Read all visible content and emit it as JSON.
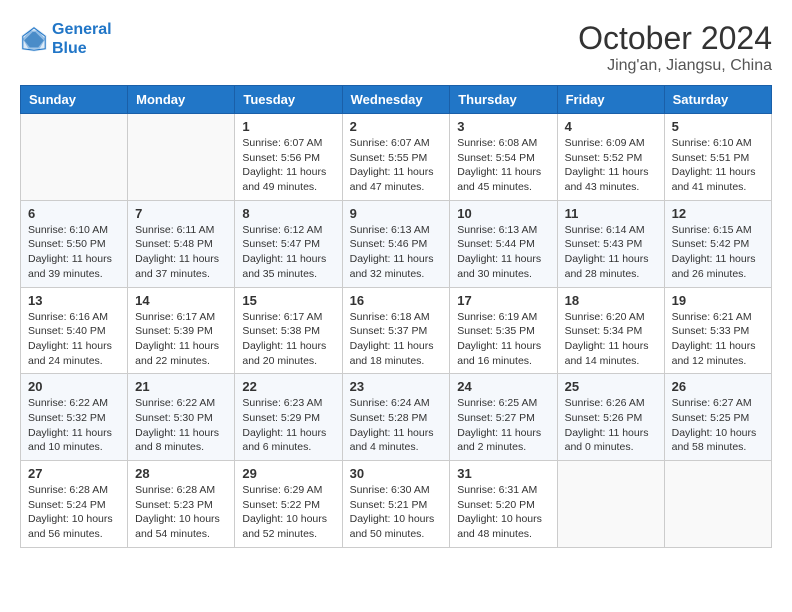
{
  "logo": {
    "line1": "General",
    "line2": "Blue"
  },
  "title": "October 2024",
  "location": "Jing'an, Jiangsu, China",
  "weekdays": [
    "Sunday",
    "Monday",
    "Tuesday",
    "Wednesday",
    "Thursday",
    "Friday",
    "Saturday"
  ],
  "weeks": [
    [
      {
        "day": "",
        "info": ""
      },
      {
        "day": "",
        "info": ""
      },
      {
        "day": "1",
        "sunrise": "Sunrise: 6:07 AM",
        "sunset": "Sunset: 5:56 PM",
        "daylight": "Daylight: 11 hours and 49 minutes."
      },
      {
        "day": "2",
        "sunrise": "Sunrise: 6:07 AM",
        "sunset": "Sunset: 5:55 PM",
        "daylight": "Daylight: 11 hours and 47 minutes."
      },
      {
        "day": "3",
        "sunrise": "Sunrise: 6:08 AM",
        "sunset": "Sunset: 5:54 PM",
        "daylight": "Daylight: 11 hours and 45 minutes."
      },
      {
        "day": "4",
        "sunrise": "Sunrise: 6:09 AM",
        "sunset": "Sunset: 5:52 PM",
        "daylight": "Daylight: 11 hours and 43 minutes."
      },
      {
        "day": "5",
        "sunrise": "Sunrise: 6:10 AM",
        "sunset": "Sunset: 5:51 PM",
        "daylight": "Daylight: 11 hours and 41 minutes."
      }
    ],
    [
      {
        "day": "6",
        "sunrise": "Sunrise: 6:10 AM",
        "sunset": "Sunset: 5:50 PM",
        "daylight": "Daylight: 11 hours and 39 minutes."
      },
      {
        "day": "7",
        "sunrise": "Sunrise: 6:11 AM",
        "sunset": "Sunset: 5:48 PM",
        "daylight": "Daylight: 11 hours and 37 minutes."
      },
      {
        "day": "8",
        "sunrise": "Sunrise: 6:12 AM",
        "sunset": "Sunset: 5:47 PM",
        "daylight": "Daylight: 11 hours and 35 minutes."
      },
      {
        "day": "9",
        "sunrise": "Sunrise: 6:13 AM",
        "sunset": "Sunset: 5:46 PM",
        "daylight": "Daylight: 11 hours and 32 minutes."
      },
      {
        "day": "10",
        "sunrise": "Sunrise: 6:13 AM",
        "sunset": "Sunset: 5:44 PM",
        "daylight": "Daylight: 11 hours and 30 minutes."
      },
      {
        "day": "11",
        "sunrise": "Sunrise: 6:14 AM",
        "sunset": "Sunset: 5:43 PM",
        "daylight": "Daylight: 11 hours and 28 minutes."
      },
      {
        "day": "12",
        "sunrise": "Sunrise: 6:15 AM",
        "sunset": "Sunset: 5:42 PM",
        "daylight": "Daylight: 11 hours and 26 minutes."
      }
    ],
    [
      {
        "day": "13",
        "sunrise": "Sunrise: 6:16 AM",
        "sunset": "Sunset: 5:40 PM",
        "daylight": "Daylight: 11 hours and 24 minutes."
      },
      {
        "day": "14",
        "sunrise": "Sunrise: 6:17 AM",
        "sunset": "Sunset: 5:39 PM",
        "daylight": "Daylight: 11 hours and 22 minutes."
      },
      {
        "day": "15",
        "sunrise": "Sunrise: 6:17 AM",
        "sunset": "Sunset: 5:38 PM",
        "daylight": "Daylight: 11 hours and 20 minutes."
      },
      {
        "day": "16",
        "sunrise": "Sunrise: 6:18 AM",
        "sunset": "Sunset: 5:37 PM",
        "daylight": "Daylight: 11 hours and 18 minutes."
      },
      {
        "day": "17",
        "sunrise": "Sunrise: 6:19 AM",
        "sunset": "Sunset: 5:35 PM",
        "daylight": "Daylight: 11 hours and 16 minutes."
      },
      {
        "day": "18",
        "sunrise": "Sunrise: 6:20 AM",
        "sunset": "Sunset: 5:34 PM",
        "daylight": "Daylight: 11 hours and 14 minutes."
      },
      {
        "day": "19",
        "sunrise": "Sunrise: 6:21 AM",
        "sunset": "Sunset: 5:33 PM",
        "daylight": "Daylight: 11 hours and 12 minutes."
      }
    ],
    [
      {
        "day": "20",
        "sunrise": "Sunrise: 6:22 AM",
        "sunset": "Sunset: 5:32 PM",
        "daylight": "Daylight: 11 hours and 10 minutes."
      },
      {
        "day": "21",
        "sunrise": "Sunrise: 6:22 AM",
        "sunset": "Sunset: 5:30 PM",
        "daylight": "Daylight: 11 hours and 8 minutes."
      },
      {
        "day": "22",
        "sunrise": "Sunrise: 6:23 AM",
        "sunset": "Sunset: 5:29 PM",
        "daylight": "Daylight: 11 hours and 6 minutes."
      },
      {
        "day": "23",
        "sunrise": "Sunrise: 6:24 AM",
        "sunset": "Sunset: 5:28 PM",
        "daylight": "Daylight: 11 hours and 4 minutes."
      },
      {
        "day": "24",
        "sunrise": "Sunrise: 6:25 AM",
        "sunset": "Sunset: 5:27 PM",
        "daylight": "Daylight: 11 hours and 2 minutes."
      },
      {
        "day": "25",
        "sunrise": "Sunrise: 6:26 AM",
        "sunset": "Sunset: 5:26 PM",
        "daylight": "Daylight: 11 hours and 0 minutes."
      },
      {
        "day": "26",
        "sunrise": "Sunrise: 6:27 AM",
        "sunset": "Sunset: 5:25 PM",
        "daylight": "Daylight: 10 hours and 58 minutes."
      }
    ],
    [
      {
        "day": "27",
        "sunrise": "Sunrise: 6:28 AM",
        "sunset": "Sunset: 5:24 PM",
        "daylight": "Daylight: 10 hours and 56 minutes."
      },
      {
        "day": "28",
        "sunrise": "Sunrise: 6:28 AM",
        "sunset": "Sunset: 5:23 PM",
        "daylight": "Daylight: 10 hours and 54 minutes."
      },
      {
        "day": "29",
        "sunrise": "Sunrise: 6:29 AM",
        "sunset": "Sunset: 5:22 PM",
        "daylight": "Daylight: 10 hours and 52 minutes."
      },
      {
        "day": "30",
        "sunrise": "Sunrise: 6:30 AM",
        "sunset": "Sunset: 5:21 PM",
        "daylight": "Daylight: 10 hours and 50 minutes."
      },
      {
        "day": "31",
        "sunrise": "Sunrise: 6:31 AM",
        "sunset": "Sunset: 5:20 PM",
        "daylight": "Daylight: 10 hours and 48 minutes."
      },
      {
        "day": "",
        "info": ""
      },
      {
        "day": "",
        "info": ""
      }
    ]
  ]
}
